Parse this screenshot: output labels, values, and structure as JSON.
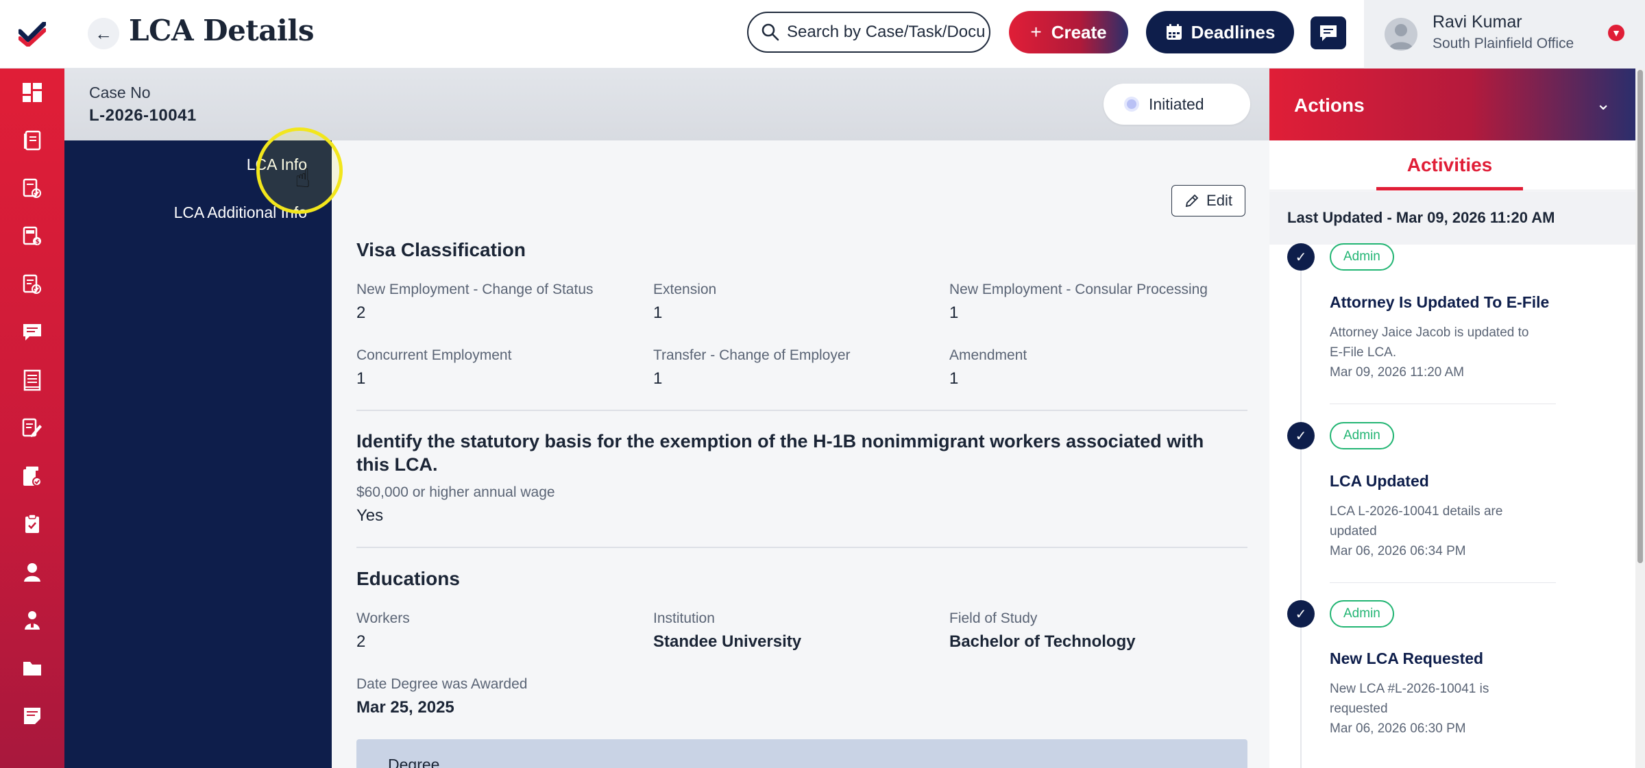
{
  "header": {
    "title": "LCA Details",
    "search_placeholder": "Search by Case/Task/Document",
    "create_label": "Create",
    "deadlines_label": "Deadlines",
    "user_name": "Ravi Kumar",
    "user_office": "South Plainfield Office"
  },
  "case": {
    "label": "Case No",
    "number": "L-2026-10041",
    "status": "Initiated"
  },
  "subnav": {
    "items": [
      "LCA Info",
      "LCA Additional Info"
    ]
  },
  "main": {
    "edit_label": "Edit",
    "visa": {
      "title": "Visa Classification",
      "fields": [
        {
          "label": "New Employment - Change of Status",
          "value": "2"
        },
        {
          "label": "Extension",
          "value": "1"
        },
        {
          "label": "New Employment - Consular Processing",
          "value": "1"
        },
        {
          "label": "Concurrent Employment",
          "value": "1"
        },
        {
          "label": "Transfer - Change of Employer",
          "value": "1"
        },
        {
          "label": "Amendment",
          "value": "1"
        }
      ]
    },
    "statutory": {
      "title_line1": "Identify the statutory basis for the exemption of the H-1B nonimmigrant workers associated with",
      "title_line2": "this LCA.",
      "label": "$60,000 or higher annual wage",
      "value": "Yes"
    },
    "educations": {
      "title": "Educations",
      "fields": [
        {
          "label": "Workers",
          "value": "2"
        },
        {
          "label": "Institution",
          "value": "Standee University"
        },
        {
          "label": "Field of Study",
          "value": "Bachelor of Technology"
        },
        {
          "label": "Date Degree was Awarded",
          "value": "Mar 25, 2025"
        }
      ],
      "table_header": "Degree"
    }
  },
  "actions": {
    "title": "Actions",
    "tab": "Activities",
    "last_updated": "Last Updated - Mar 09, 2026 11:20 AM",
    "items": [
      {
        "badge": "Admin",
        "title": "Attorney Is Updated To E-File",
        "desc": "Attorney Jaice Jacob is updated to E-File LCA.",
        "time": "Mar 09, 2026 11:20 AM"
      },
      {
        "badge": "Admin",
        "title": "LCA Updated",
        "desc": "LCA L-2026-10041 details are updated",
        "time": "Mar 06, 2026 06:34 PM"
      },
      {
        "badge": "Admin",
        "title": "New LCA Requested",
        "desc": "New LCA #L-2026-10041 is requested",
        "time": "Mar 06, 2026 06:30 PM"
      }
    ]
  },
  "rail_icons": [
    "dashboard-icon",
    "cases-icon",
    "tasks-icon",
    "invoices-icon",
    "lca-icon",
    "messages-icon",
    "documents-icon",
    "forms-icon",
    "templates-icon",
    "checklist-icon",
    "clients-icon",
    "contacts-icon",
    "folder-icon",
    "notes-icon"
  ],
  "colors": {
    "brand_red": "#e01e37",
    "navy": "#0e1e4b",
    "badge_green": "#22b573"
  }
}
